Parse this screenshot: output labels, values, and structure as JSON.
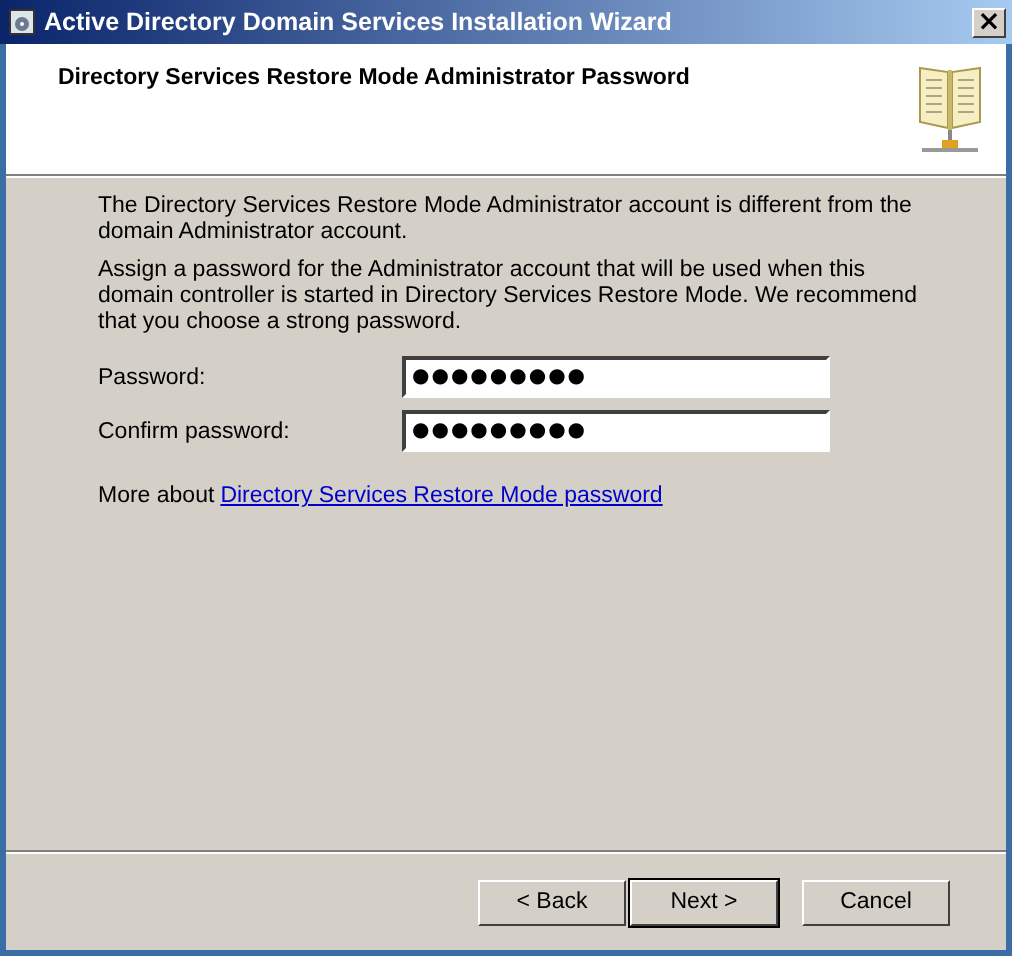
{
  "window": {
    "title": "Active Directory Domain Services Installation Wizard",
    "close": "×"
  },
  "header": {
    "title": "Directory Services Restore Mode Administrator Password"
  },
  "paragraphs": [
    "The Directory Services Restore Mode Administrator account is different from the domain Administrator account.",
    "Assign a password for the Administrator account that will be used when this domain controller is started in Directory Services Restore Mode. We recommend that you choose a strong password."
  ],
  "fields": [
    {
      "label": "Password:",
      "value": "●●●●●●●●●"
    },
    {
      "label": "Confirm password:",
      "value": "●●●●●●●●●"
    }
  ],
  "more": {
    "text": "More about",
    "link": "Directory Services Restore Mode password"
  },
  "buttons": [
    {
      "label": "< Back",
      "default": false
    },
    {
      "label": "Next >",
      "default": true
    },
    {
      "label": "Cancel",
      "default": false
    }
  ]
}
